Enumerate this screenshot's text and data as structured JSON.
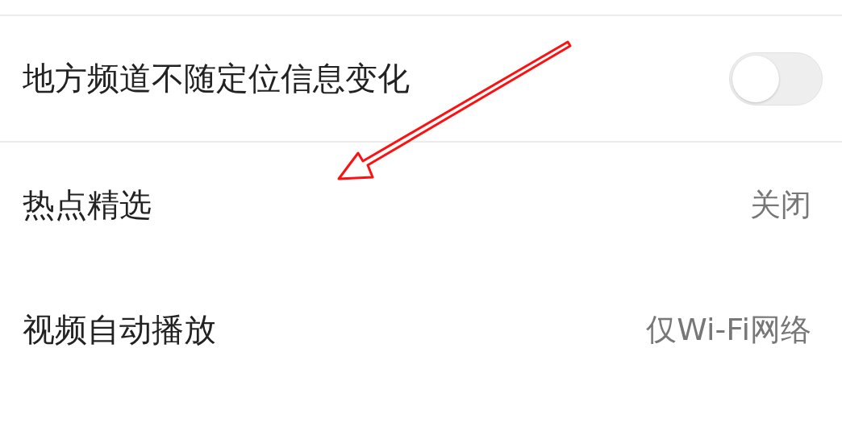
{
  "settings": [
    {
      "kind": "toggle",
      "label": "地方频道不随定位信息变化",
      "on": false
    },
    {
      "kind": "value",
      "label": "热点精选",
      "value": "关闭"
    },
    {
      "kind": "value",
      "label": "视频自动播放",
      "value": "仅Wi-Fi网络"
    }
  ]
}
